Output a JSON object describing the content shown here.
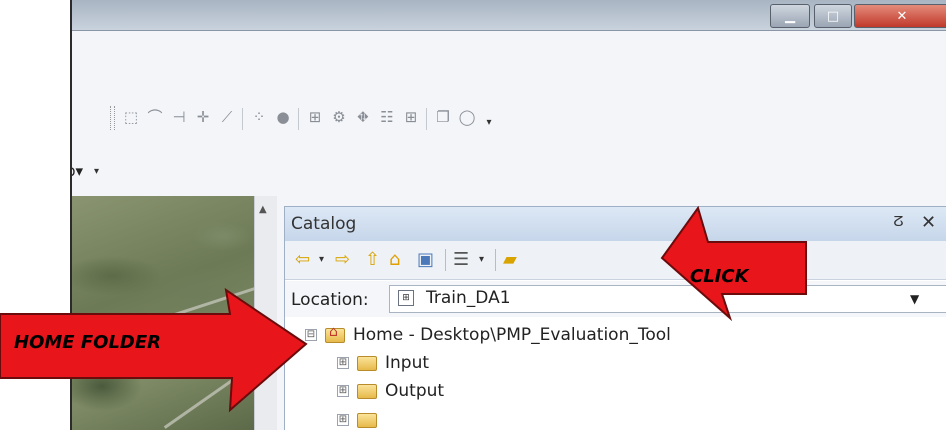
{
  "window": {
    "controls": {
      "minimize_icon": "minimize-icon",
      "maximize_icon": "maximize-icon",
      "close_icon": "close-icon"
    }
  },
  "toolbar": {
    "partial_dropdown": "p▾"
  },
  "catalog": {
    "title": "Catalog",
    "pin_icon": "pin-icon",
    "close_icon": "close-icon",
    "toolbar_icons": [
      "back-icon",
      "back-dropdown-icon",
      "forward-icon",
      "up-one-level-icon",
      "home-icon",
      "connect-folder-icon",
      "view-list-icon",
      "view-dropdown-icon",
      "new-folder-icon"
    ],
    "location_label": "Location:",
    "location_value": "Train_DA1",
    "tree": [
      {
        "label": "Home - Desktop\\PMP_Evaluation_Tool",
        "expander": "⊟",
        "icon": "home-folder-icon"
      },
      {
        "label": "Input",
        "expander": "⊞",
        "icon": "folder-icon"
      },
      {
        "label": "Output",
        "expander": "⊞",
        "icon": "folder-icon"
      }
    ]
  },
  "annotations": {
    "click": "CLICK",
    "home_folder": "HOME FOLDER",
    "arrow_color": "#e8151b"
  }
}
